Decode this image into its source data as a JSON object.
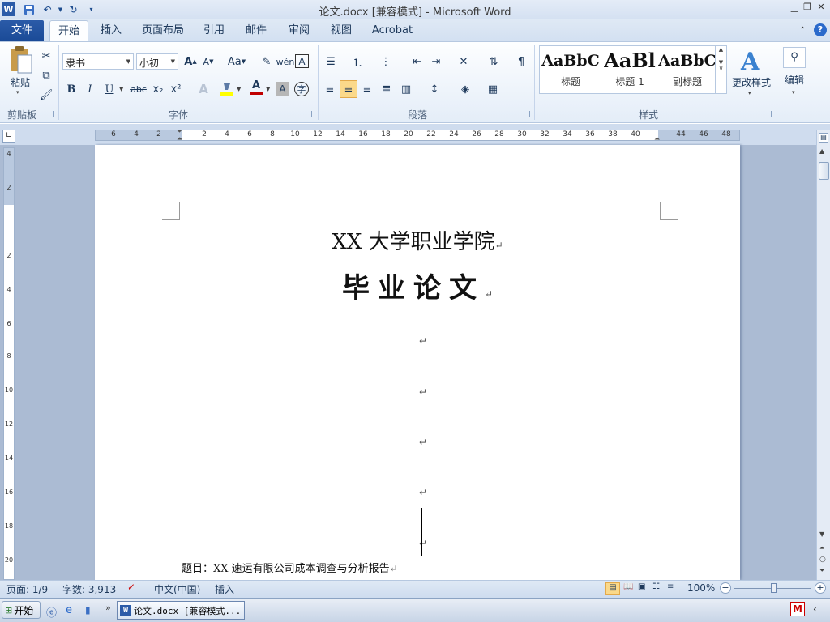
{
  "window": {
    "title": "论文.docx [兼容模式] - Microsoft Word"
  },
  "tabs": {
    "file": "文件",
    "items": [
      "开始",
      "插入",
      "页面布局",
      "引用",
      "邮件",
      "审阅",
      "视图",
      "Acrobat"
    ],
    "active": "开始"
  },
  "clipboard": {
    "paste": "粘贴",
    "group": "剪贴板"
  },
  "font": {
    "name": "隶书",
    "size": "小初",
    "group": "字体",
    "grow": "A",
    "shrink": "A",
    "case": "Aa",
    "bold": "B",
    "italic": "I",
    "underline": "U",
    "strike": "abc",
    "subscript": "x₂",
    "superscript": "x²",
    "color_letter": "A",
    "accent_color": "#c00000",
    "highlight_color": "#ffff00"
  },
  "paragraph": {
    "group": "段落"
  },
  "styles": {
    "group": "样式",
    "items": [
      {
        "sample": "AaBbC",
        "name": "标题"
      },
      {
        "sample": "AaBl",
        "name": "标题 1"
      },
      {
        "sample": "AaBbC",
        "name": "副标题"
      }
    ],
    "change": "更改样式"
  },
  "editing": {
    "label": "编辑"
  },
  "ruler": {
    "h_ticks": [
      "6",
      "4",
      "2",
      "2",
      "4",
      "6",
      "8",
      "10",
      "12",
      "14",
      "16",
      "18",
      "20",
      "22",
      "24",
      "26",
      "28",
      "30",
      "32",
      "34",
      "36",
      "38",
      "40",
      "44",
      "46",
      "48"
    ],
    "v_ticks": [
      "4",
      "2",
      "2",
      "4",
      "6",
      "8",
      "10",
      "12",
      "14",
      "16",
      "18",
      "20"
    ]
  },
  "document": {
    "title": "XX 大学职业学院",
    "subtitle": "毕业论文",
    "para_mark": "↵",
    "topic": "题目：XX 速运有限公司成本调查与分析报告"
  },
  "status": {
    "page": "页面: 1/9",
    "words": "字数: 3,913",
    "language": "中文(中国)",
    "mode": "插入",
    "zoom": "100%"
  },
  "taskbar": {
    "start": "开始",
    "word_task": "论文.docx [兼容模式..."
  }
}
